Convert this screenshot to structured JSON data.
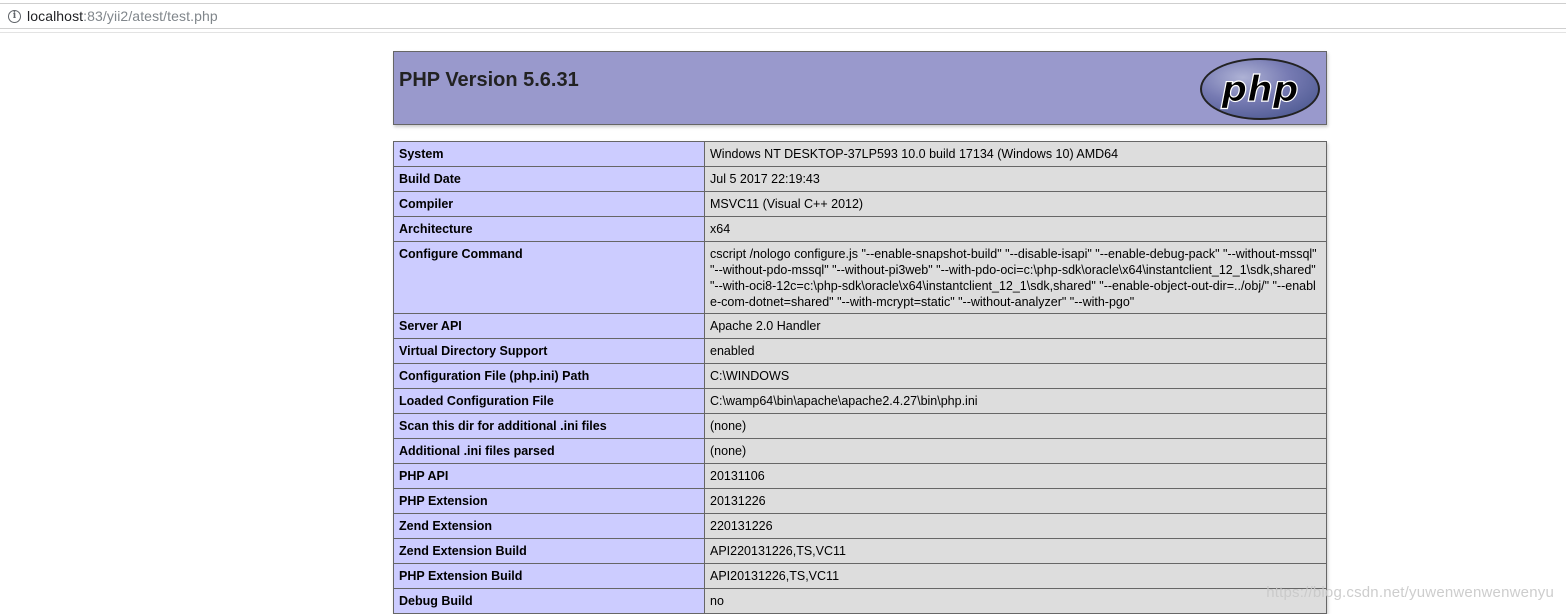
{
  "browser": {
    "url_host": "localhost",
    "url_rest": ":83/yii2/atest/test.php",
    "info_icon": "info-icon"
  },
  "header": {
    "title": "PHP Version 5.6.31",
    "logo_text": "php"
  },
  "rows": [
    {
      "label": "System",
      "value": "Windows NT DESKTOP-37LP593 10.0 build 17134 (Windows 10) AMD64"
    },
    {
      "label": "Build Date",
      "value": "Jul 5 2017 22:19:43"
    },
    {
      "label": "Compiler",
      "value": "MSVC11 (Visual C++ 2012)"
    },
    {
      "label": "Architecture",
      "value": "x64"
    },
    {
      "label": "Configure Command",
      "value": "cscript /nologo configure.js \"--enable-snapshot-build\" \"--disable-isapi\" \"--enable-debug-pack\" \"--without-mssql\" \"--without-pdo-mssql\" \"--without-pi3web\" \"--with-pdo-oci=c:\\php-sdk\\oracle\\x64\\instantclient_12_1\\sdk,shared\" \"--with-oci8-12c=c:\\php-sdk\\oracle\\x64\\instantclient_12_1\\sdk,shared\" \"--enable-object-out-dir=../obj/\" \"--enable-com-dotnet=shared\" \"--with-mcrypt=static\" \"--without-analyzer\" \"--with-pgo\""
    },
    {
      "label": "Server API",
      "value": "Apache 2.0 Handler"
    },
    {
      "label": "Virtual Directory Support",
      "value": "enabled"
    },
    {
      "label": "Configuration File (php.ini) Path",
      "value": "C:\\WINDOWS"
    },
    {
      "label": "Loaded Configuration File",
      "value": "C:\\wamp64\\bin\\apache\\apache2.4.27\\bin\\php.ini"
    },
    {
      "label": "Scan this dir for additional .ini files",
      "value": "(none)"
    },
    {
      "label": "Additional .ini files parsed",
      "value": "(none)"
    },
    {
      "label": "PHP API",
      "value": "20131106"
    },
    {
      "label": "PHP Extension",
      "value": "20131226"
    },
    {
      "label": "Zend Extension",
      "value": "220131226"
    },
    {
      "label": "Zend Extension Build",
      "value": "API220131226,TS,VC11"
    },
    {
      "label": "PHP Extension Build",
      "value": "API20131226,TS,VC11"
    },
    {
      "label": "Debug Build",
      "value": "no"
    }
  ],
  "watermark": "https://blog.csdn.net/yuwenwenwenwenyu"
}
